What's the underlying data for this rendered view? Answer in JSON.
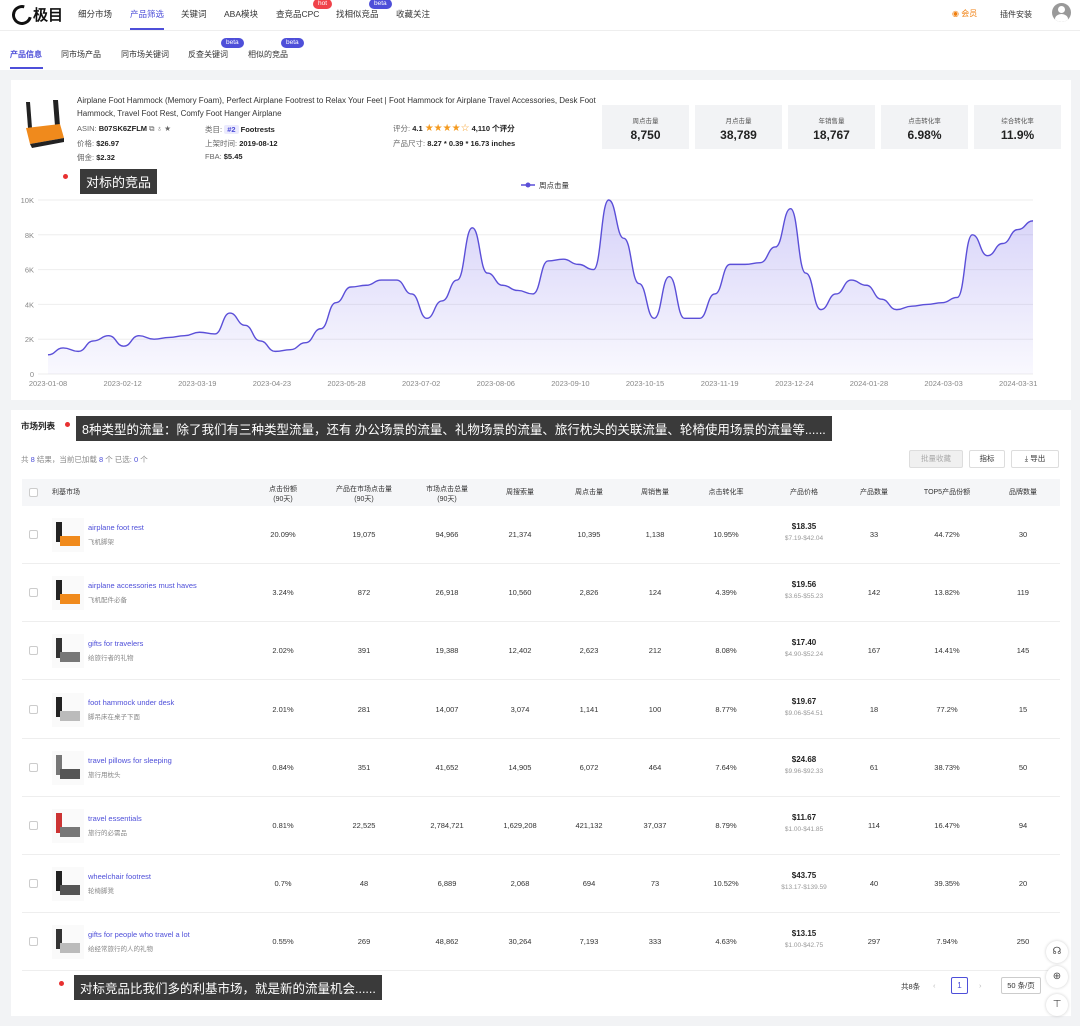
{
  "nav": {
    "items": [
      "细分市场",
      "产品筛选",
      "关键词",
      "ABA模块",
      "查竞品CPC",
      "找相似竞品",
      "收藏关注"
    ],
    "hot_badge": "hot",
    "beta_badge": "beta",
    "member": "会员",
    "plugin": "插件安装"
  },
  "subnav": {
    "items": [
      "产品信息",
      "同市场产品",
      "同市场关键词",
      "反查关键词",
      "相似的竞品"
    ],
    "beta_badge": "beta"
  },
  "product": {
    "title": "Airplane Foot Hammock (Memory Foam), Perfect Airplane Footrest to Relax Your Feet | Foot Hammock for Airplane Travel Accessories, Desk Foot Hammock, Travel Foot Rest, Comfy Foot Hanger Airplane",
    "asin_label": "ASIN:",
    "asin": "B07SK6ZFLM",
    "price_label": "价格:",
    "price": "$26.97",
    "commission_label": "佣金:",
    "commission": "$2.32",
    "category_label": "类目:",
    "category_rank": "#2",
    "category": "Footrests",
    "listed_label": "上架时间:",
    "listed": "2019-08-12",
    "fba_label": "FBA:",
    "fba": "$5.45",
    "rating_label": "评分:",
    "rating": "4.1",
    "reviews": "4,110 个评分",
    "size_label": "产品尺寸:",
    "size": "8.27 * 0.39 * 16.73 inches"
  },
  "stats": [
    {
      "label": "周点击量",
      "value": "8,750"
    },
    {
      "label": "月点击量",
      "value": "38,789"
    },
    {
      "label": "年销售量",
      "value": "18,767"
    },
    {
      "label": "点击转化率",
      "value": "6.98%"
    },
    {
      "label": "综合转化率",
      "value": "11.9%"
    }
  ],
  "annotations": {
    "a1": "对标的竞品",
    "a2": "8种类型的流量：除了我们有三种类型流量，还有 办公场景的流量、礼物场景的流量、旅行枕头的关联流量、轮椅使用场景的流量等......",
    "a3": "对标竞品比我们多的利基市场，就是新的流量机会......"
  },
  "chart_data": {
    "type": "area",
    "legend": "周点击量",
    "legend_position": "top-center",
    "yticks": [
      "0",
      "2K",
      "4K",
      "6K",
      "8K",
      "10K"
    ],
    "ylim": [
      0,
      10000
    ],
    "xticks": [
      "2023-01-08",
      "2023-02-12",
      "2023-03-19",
      "2023-04-23",
      "2023-05-28",
      "2023-07-02",
      "2023-08-06",
      "2023-09-10",
      "2023-10-15",
      "2023-11-19",
      "2023-12-24",
      "2024-01-28",
      "2024-03-03",
      "2024-03-31"
    ],
    "color": "#5b4fd8",
    "values": [
      1100,
      1500,
      1300,
      1900,
      2200,
      1600,
      2200,
      2000,
      2100,
      2200,
      2400,
      2300,
      3500,
      2800,
      1900,
      1300,
      1400,
      1800,
      2600,
      4100,
      5000,
      5100,
      5400,
      5400,
      4600,
      3200,
      4200,
      5400,
      8400,
      5800,
      5100,
      4800,
      4600,
      6500,
      6600,
      6300,
      6000,
      10000,
      7800,
      5200,
      3200,
      5600,
      3200,
      3200,
      4600,
      6300,
      6300,
      6400,
      7300,
      9500,
      5800,
      3700,
      4600,
      5400,
      5100,
      4300,
      3700,
      3900,
      4000,
      4100,
      4400,
      8000,
      6800,
      7500,
      8300,
      8800
    ]
  },
  "market": {
    "title": "市场列表",
    "count_prefix": "共 ",
    "count_total": "8",
    "count_mid": " 结果，当前已加载 ",
    "count_loaded": "8",
    "count_mid2": " 个   已选: ",
    "count_selected": "0",
    "count_suffix": " 个",
    "btn_batch": "批量收藏",
    "btn_metrics": "指标",
    "btn_export": "导出",
    "headers": [
      "利基市场",
      "点击份额\n(90天)",
      "产品在市场点击量\n(90天)",
      "市场点击总量\n(90天)",
      "周搜索量",
      "周点击量",
      "周销售量",
      "点击转化率",
      "产品价格",
      "产品数量",
      "TOP5产品份额",
      "品牌数量"
    ],
    "rows": [
      {
        "kw": "airplane foot rest",
        "cn": "飞机脚架",
        "share": "20.09%",
        "pclicks": "19,075",
        "mclicks": "94,966",
        "search": "21,374",
        "wclicks": "10,395",
        "sales": "1,138",
        "cvr": "10.95%",
        "price": "$18.35",
        "range": "$7.19-$42.04",
        "products": "33",
        "top5": "44.72%",
        "brands": "30"
      },
      {
        "kw": "airplane accessories must haves",
        "cn": "飞机配件必备",
        "share": "3.24%",
        "pclicks": "872",
        "mclicks": "26,918",
        "search": "10,560",
        "wclicks": "2,826",
        "sales": "124",
        "cvr": "4.39%",
        "price": "$19.56",
        "range": "$3.65-$55.23",
        "products": "142",
        "top5": "13.82%",
        "brands": "119"
      },
      {
        "kw": "gifts for travelers",
        "cn": "给旅行者的礼物",
        "share": "2.02%",
        "pclicks": "391",
        "mclicks": "19,388",
        "search": "12,402",
        "wclicks": "2,623",
        "sales": "212",
        "cvr": "8.08%",
        "price": "$17.40",
        "range": "$4.90-$52.24",
        "products": "167",
        "top5": "14.41%",
        "brands": "145"
      },
      {
        "kw": "foot hammock under desk",
        "cn": "脚吊床在桌子下面",
        "share": "2.01%",
        "pclicks": "281",
        "mclicks": "14,007",
        "search": "3,074",
        "wclicks": "1,141",
        "sales": "100",
        "cvr": "8.77%",
        "price": "$19.67",
        "range": "$9.06-$54.51",
        "products": "18",
        "top5": "77.2%",
        "brands": "15"
      },
      {
        "kw": "travel pillows for sleeping",
        "cn": "旅行用枕头",
        "share": "0.84%",
        "pclicks": "351",
        "mclicks": "41,652",
        "search": "14,905",
        "wclicks": "6,072",
        "sales": "464",
        "cvr": "7.64%",
        "price": "$24.68",
        "range": "$9.96-$92.33",
        "products": "61",
        "top5": "38.73%",
        "brands": "50"
      },
      {
        "kw": "travel essentials",
        "cn": "旅行的必需品",
        "share": "0.81%",
        "pclicks": "22,525",
        "mclicks": "2,784,721",
        "search": "1,629,208",
        "wclicks": "421,132",
        "sales": "37,037",
        "cvr": "8.79%",
        "price": "$11.67",
        "range": "$1.00-$41.85",
        "products": "114",
        "top5": "16.47%",
        "brands": "94"
      },
      {
        "kw": "wheelchair footrest",
        "cn": "轮椅脚凳",
        "share": "0.7%",
        "pclicks": "48",
        "mclicks": "6,889",
        "search": "2,068",
        "wclicks": "694",
        "sales": "73",
        "cvr": "10.52%",
        "price": "$43.75",
        "range": "$13.17-$139.59",
        "products": "40",
        "top5": "39.35%",
        "brands": "20"
      },
      {
        "kw": "gifts for people who travel a lot",
        "cn": "给经常旅行的人的礼物",
        "share": "0.55%",
        "pclicks": "269",
        "mclicks": "48,862",
        "search": "30,264",
        "wclicks": "7,193",
        "sales": "333",
        "cvr": "4.63%",
        "price": "$13.15",
        "range": "$1.00-$42.75",
        "products": "297",
        "top5": "7.94%",
        "brands": "250"
      }
    ],
    "pager_total": "共8条",
    "pager_page": "1",
    "pager_size": "50 条/页"
  }
}
